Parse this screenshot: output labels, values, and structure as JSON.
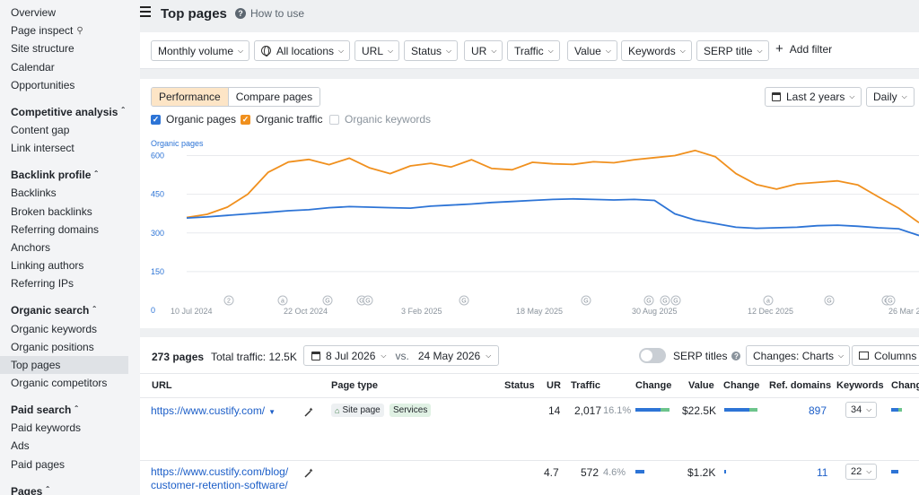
{
  "sidebar": {
    "top_items": [
      "Overview",
      "Page inspect",
      "Site structure",
      "Calendar",
      "Opportunities"
    ],
    "sections": [
      {
        "title": "Competitive analysis",
        "items": [
          "Content gap",
          "Link intersect"
        ]
      },
      {
        "title": "Backlink profile",
        "items": [
          "Backlinks",
          "Broken backlinks",
          "Referring domains",
          "Anchors",
          "Linking authors",
          "Referring IPs"
        ]
      },
      {
        "title": "Organic search",
        "items": [
          "Organic keywords",
          "Organic positions",
          "Top pages",
          "Organic competitors"
        ]
      },
      {
        "title": "Paid search",
        "items": [
          "Paid keywords",
          "Ads",
          "Paid pages"
        ]
      },
      {
        "title": "Pages",
        "items": []
      }
    ],
    "active_item": "Top pages"
  },
  "header": {
    "title": "Top pages",
    "how_to": "How to use"
  },
  "filters": {
    "monthly_volume": "Monthly volume",
    "locations": "All locations",
    "url": "URL",
    "status": "Status",
    "ur": "UR",
    "traffic": "Traffic",
    "value": "Value",
    "keywords": "Keywords",
    "serp_title": "SERP title",
    "add_filter": "Add filter"
  },
  "chart_panel": {
    "tab_performance": "Performance",
    "tab_compare": "Compare pages",
    "range": "Last 2 years",
    "granularity": "Daily",
    "legend": {
      "organic_pages": "Organic pages",
      "organic_traffic": "Organic traffic",
      "organic_keywords": "Organic keywords"
    }
  },
  "chart_data": {
    "type": "line",
    "ylabel": "Organic pages",
    "ylim": [
      0,
      640
    ],
    "yticks": [
      0,
      150,
      300,
      450,
      600
    ],
    "xticks": [
      "10 Jul 2024",
      "22 Oct 2024",
      "3 Feb 2025",
      "18 May 2025",
      "30 Aug 2025",
      "12 Dec 2025",
      "26 Mar 2026"
    ],
    "grid": true,
    "series": [
      {
        "name": "Organic pages",
        "color": "#2d74d6",
        "values": [
          358,
          362,
          368,
          374,
          380,
          386,
          390,
          398,
          402,
          400,
          398,
          396,
          404,
          408,
          412,
          418,
          422,
          426,
          430,
          432,
          430,
          428,
          430,
          426,
          374,
          350,
          336,
          322,
          318,
          320,
          322,
          328,
          330,
          326,
          320,
          316,
          290
        ]
      },
      {
        "name": "Organic traffic",
        "color": "#f0901e",
        "values": [
          360,
          372,
          400,
          450,
          535,
          575,
          585,
          565,
          590,
          552,
          530,
          560,
          570,
          556,
          584,
          550,
          545,
          574,
          568,
          566,
          576,
          572,
          584,
          592,
          600,
          620,
          595,
          530,
          488,
          470,
          490,
          496,
          502,
          486,
          440,
          396,
          340
        ]
      }
    ],
    "event_markers": [
      "2",
      "a",
      "G",
      "G",
      "G",
      "G",
      "G",
      "G",
      "G",
      "G",
      "a",
      "G",
      "G",
      "G",
      "G"
    ]
  },
  "table_panel": {
    "pages_count": "273 pages",
    "total_traffic": "Total traffic: 12.5K",
    "date_from": "8 Jul 2026",
    "vs": "vs.",
    "date_to": "24 May 2026",
    "serp_titles": "SERP titles",
    "changes": "Changes: Charts",
    "columns": "Columns",
    "headers": {
      "url": "URL",
      "page_type": "Page type",
      "status": "Status",
      "ur": "UR",
      "traffic": "Traffic",
      "change": "Change",
      "value": "Value",
      "change2": "Change",
      "ref_domains": "Ref. domains",
      "keywords": "Keywords",
      "change3": "Chang"
    },
    "rows": [
      {
        "url": "https://www.custify.com/",
        "page_type_1": "Site page",
        "page_type_2": "Services",
        "ur": "14",
        "traffic": "2,017",
        "traffic_pct": "16.1%",
        "value": "$22.5K",
        "ref_domains": "897",
        "keywords": "34"
      },
      {
        "url_line1": "https://www.custify.com/blog/",
        "url_line2": "customer-retention-software/",
        "ur": "4.7",
        "traffic": "572",
        "traffic_pct": "4.6%",
        "value": "$1.2K",
        "ref_domains": "11",
        "keywords": "22"
      }
    ]
  },
  "colors": {
    "blue": "#2d74d6",
    "orange": "#f0901e",
    "link": "#1d5fc8",
    "active_tab": "#fde5c6"
  }
}
